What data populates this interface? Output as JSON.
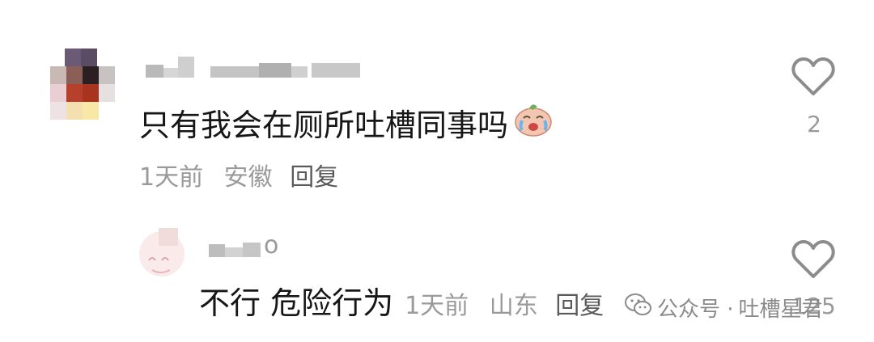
{
  "comments": [
    {
      "username": "",
      "text": "只有我会在厕所吐槽同事吗",
      "emoji": "😭",
      "time": "1天前",
      "location": "安徽",
      "reply_label": "回复",
      "like_count": "2"
    },
    {
      "username": "o",
      "text": "不行 危险行为",
      "time": "1天前",
      "location": "山东",
      "reply_label": "回复",
      "like_count": "125"
    }
  ],
  "watermark": {
    "prefix": "公众号 · ",
    "name": "吐槽星君"
  },
  "colors": {
    "text_primary": "#161616",
    "text_meta": "#9a9a9a",
    "heart_stroke": "#8c8c8c"
  },
  "icons": {
    "heart": "heart-outline-icon",
    "wechat": "wechat-icon"
  }
}
